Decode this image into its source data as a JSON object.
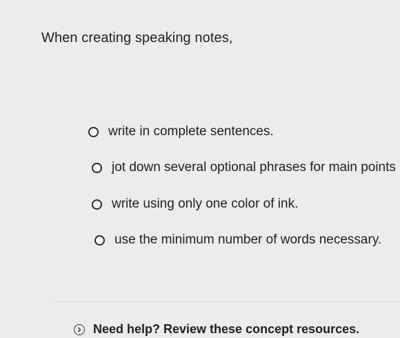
{
  "question": {
    "prompt": "When creating speaking notes,"
  },
  "options": [
    {
      "label": "write in complete sentences."
    },
    {
      "label": "jot down several optional phrases for main points"
    },
    {
      "label": "write using only one color of ink."
    },
    {
      "label": "use the minimum number of words necessary."
    }
  ],
  "help": {
    "icon": "chevron-right-icon",
    "label": "Need help? Review these concept resources."
  }
}
